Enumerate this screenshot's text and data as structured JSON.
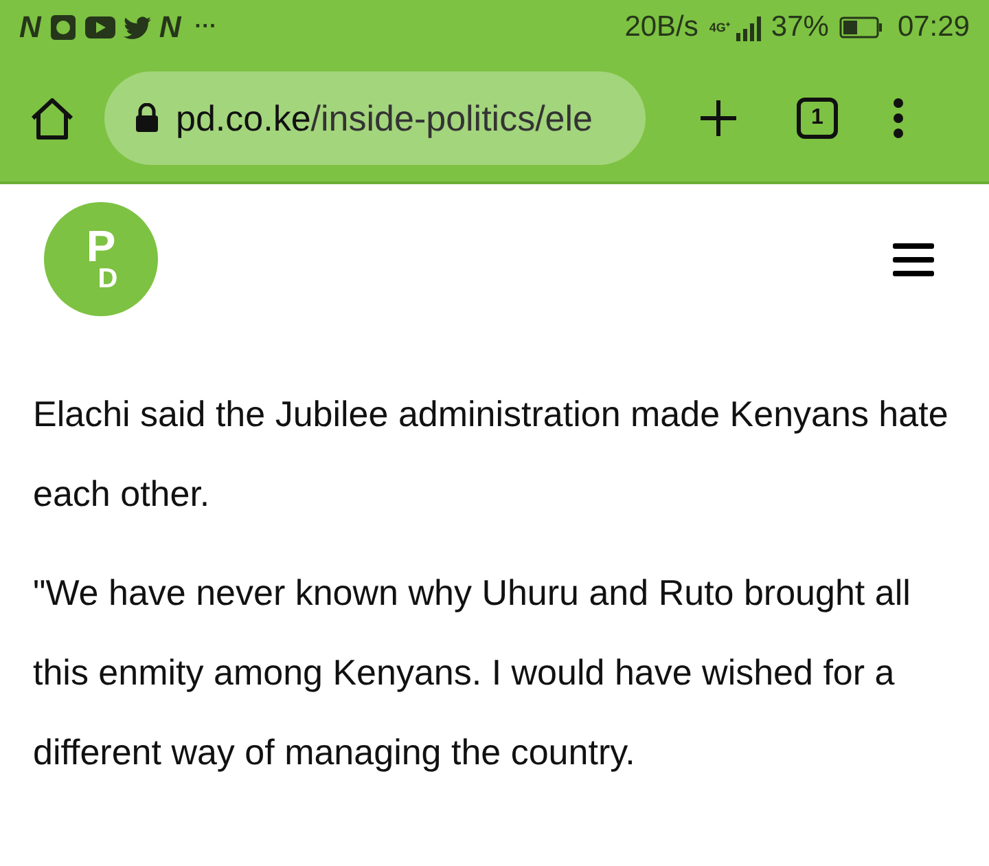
{
  "status_bar": {
    "notifications": [
      {
        "kind": "letter",
        "text": "N"
      },
      {
        "kind": "app"
      },
      {
        "kind": "youtube"
      },
      {
        "kind": "twitter"
      },
      {
        "kind": "letter",
        "text": "N"
      }
    ],
    "more": "···",
    "speed": "20B/s",
    "network": "4G⁺",
    "battery": "37%",
    "time": "07:29"
  },
  "browser": {
    "url_host": "pd.co.ke",
    "url_path": "/inside-politics/ele",
    "tab_count": "1"
  },
  "site_header": {
    "logo_letters": [
      "P",
      "D"
    ]
  },
  "article": {
    "paragraphs": [
      "Elachi said the Jubilee administration made Kenyans hate each other.",
      "\"We have never known why Uhuru and Ruto brought all this enmity among Kenyans. I would have wished for a different way of managing the country."
    ]
  }
}
